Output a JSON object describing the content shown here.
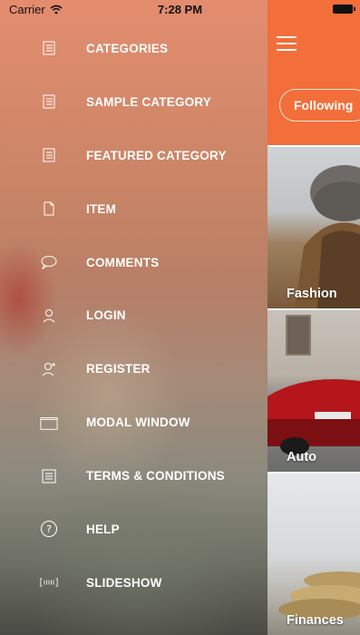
{
  "status_bar": {
    "carrier": "Carrier",
    "time": "7:28 PM"
  },
  "menu": {
    "items": [
      {
        "label": "CATEGORIES",
        "icon": "list-icon"
      },
      {
        "label": "SAMPLE CATEGORY",
        "icon": "list-icon"
      },
      {
        "label": "FEATURED CATEGORY",
        "icon": "list-icon"
      },
      {
        "label": "ITEM",
        "icon": "document-icon"
      },
      {
        "label": "COMMENTS",
        "icon": "speech-bubble-icon"
      },
      {
        "label": "LOGIN",
        "icon": "user-icon"
      },
      {
        "label": "REGISTER",
        "icon": "user-add-icon"
      },
      {
        "label": "MODAL WINDOW",
        "icon": "window-icon"
      },
      {
        "label": "TERMS & CONDITIONS",
        "icon": "checklist-icon"
      },
      {
        "label": "HELP",
        "icon": "question-circle-icon"
      },
      {
        "label": "SLIDESHOW",
        "icon": "slideshow-icon"
      }
    ]
  },
  "content": {
    "pill_label": "Following",
    "cards": [
      {
        "label": "Fashion"
      },
      {
        "label": "Auto"
      },
      {
        "label": "Finances"
      }
    ]
  },
  "colors": {
    "accent": "#f26e3a"
  }
}
